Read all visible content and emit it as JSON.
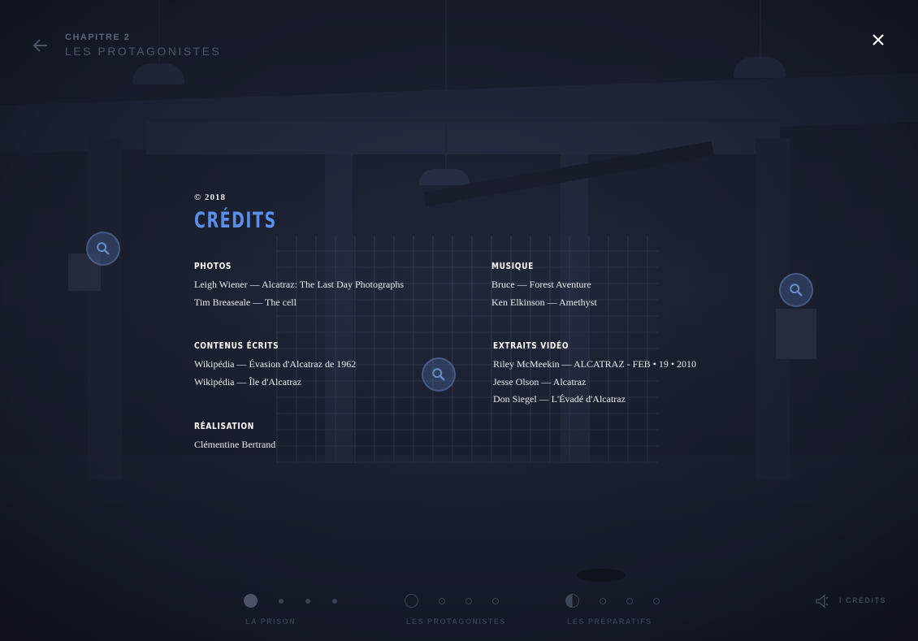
{
  "header": {
    "chapter_number": "CHAPITRE 2",
    "chapter_title": "LES PROTAGONISTES"
  },
  "credits": {
    "year": "© 2018",
    "title": "CRÉDITS",
    "sections": {
      "photos": {
        "heading": "PHOTOS",
        "lines": [
          "Leigh Wiener — Alcatraz: The Last Day Photographs",
          "Tim Breaseale — The cell"
        ]
      },
      "musique": {
        "heading": "MUSIQUE",
        "lines": [
          "Bruce — Forest Aventure",
          "Ken Elkinson — Amethyst"
        ]
      },
      "contenus": {
        "heading": "CONTENUS ÉCRITS",
        "lines": [
          "Wikipédia — Évasion d'Alcatraz de 1962",
          "Wikipédia — Île d'Alcatraz"
        ]
      },
      "extraits": {
        "heading": "EXTRAITS VIDÉO",
        "lines": [
          "Riley McMeekin — ALCATRAZ - FEB • 19 • 2010",
          "Jesse Olson — Alcatraz",
          "Don Siegel — L'Évadé d'Alcatraz"
        ]
      },
      "realisation": {
        "heading": "RÉALISATION",
        "lines": [
          "Clémentine Bertrand"
        ]
      }
    }
  },
  "bottom_nav": {
    "chapters": [
      {
        "label": "LA PRISON",
        "state": "active"
      },
      {
        "label": "LES PROTAGONISTES",
        "state": "outline"
      },
      {
        "label": "LES PRÉPARATIFS",
        "state": "half"
      }
    ],
    "credits_link": "I  CRÉDITS"
  },
  "icons": {
    "back": "arrow-left-icon",
    "close": "close-icon",
    "hotspot": "magnifier-icon",
    "sound": "speaker-icon"
  },
  "colors": {
    "accent": "#5b8ee6",
    "background": "#15192a",
    "text": "#e9ebf1"
  }
}
